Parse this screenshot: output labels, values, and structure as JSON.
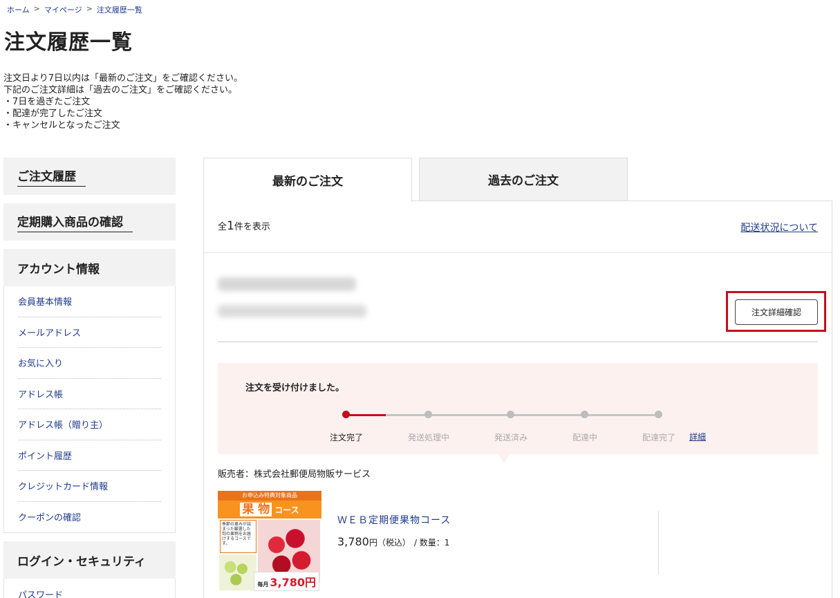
{
  "breadcrumb": {
    "items": [
      "ホーム",
      "マイページ",
      "注文履歴一覧"
    ],
    "separator": ">"
  },
  "page": {
    "title": "注文履歴一覧",
    "notice": [
      "注文日より7日以内は「最新のご注文」をご確認ください。",
      "下記のご注文詳細は「過去のご注文」をご確認ください。",
      "・7日を過ぎたご注文",
      "・配達が完了したご注文",
      "・キャンセルとなったご注文"
    ]
  },
  "sidebar": {
    "order_history": "ご注文履歴",
    "subscription": "定期購入商品の確認",
    "account": {
      "title": "アカウント情報",
      "items": [
        "会員基本情報",
        "メールアドレス",
        "お気に入り",
        "アドレス帳",
        "アドレス帳（贈り主）",
        "ポイント履歴",
        "クレジットカード情報",
        "クーポンの確認"
      ]
    },
    "login_security": {
      "title": "ログイン・セキュリティ",
      "items": [
        "パスワード"
      ]
    }
  },
  "tabs": [
    "最新のご注文",
    "過去のご注文"
  ],
  "results": {
    "prefix": "全",
    "count": "1",
    "suffix": "件を表示",
    "shipping_link": "配送状況について"
  },
  "order": {
    "detail_button": "注文詳細確認",
    "status_message": "注文を受け付けました。",
    "steps": [
      "注文完了",
      "発送処理中",
      "発送済み",
      "配達中",
      "配達完了"
    ],
    "current_step": 0,
    "steps_detail_link": "詳細",
    "seller": "販売者：株式会社郵便局物販サービス",
    "product": {
      "name": "ＷＥＢ定期便果物コース",
      "price": "3,780",
      "price_unit": "円",
      "tax_label": "（税込）",
      "quantity_text": "/ 数量：1",
      "image": {
        "banner": "お申込み特典対象商品",
        "title_big": "果 物",
        "title_small": "コース",
        "desc": "季節の恵みが詰まった厳選した旬の果物をお届けするコースです。",
        "price_label": "毎月",
        "price_value": "3,780円"
      }
    }
  },
  "colors": {
    "accent": "#c0101a",
    "link": "#1f3b8c",
    "status_bg": "#fdf1f0"
  }
}
